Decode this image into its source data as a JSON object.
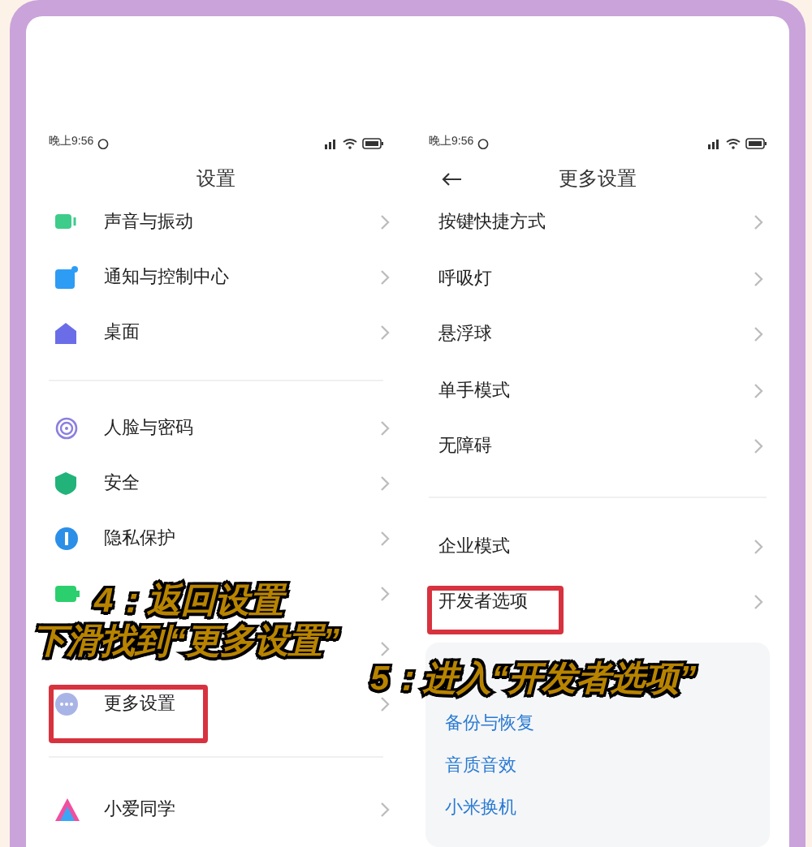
{
  "screens": [
    {
      "status_bar": {
        "time": "晚上9:56"
      },
      "title": "设置",
      "back": false,
      "groups": [
        {
          "items": [
            {
              "kind": "sound",
              "label": "声音与振动"
            },
            {
              "kind": "notice",
              "label": "通知与控制中心"
            },
            {
              "kind": "home",
              "label": "桌面"
            }
          ]
        },
        {
          "items": [
            {
              "kind": "face",
              "label": "人脸与密码"
            },
            {
              "kind": "shield",
              "label": "安全"
            },
            {
              "kind": "privacy",
              "label": "隐私保护"
            },
            {
              "kind": "battery"
            },
            {
              "kind": "covered"
            },
            {
              "kind": "more",
              "label": "更多设置"
            }
          ]
        },
        {
          "items": [
            {
              "kind": "assistant",
              "label": "小爱同学"
            }
          ]
        }
      ]
    },
    {
      "status_bar": {
        "time": "晚上9:56"
      },
      "title": "更多设置",
      "back": true,
      "groups": [
        {
          "items": [
            {
              "label": "按键快捷方式"
            },
            {
              "label": "呼吸灯"
            },
            {
              "label": "悬浮球"
            },
            {
              "label": "单手模式"
            },
            {
              "label": "无障碍"
            }
          ]
        },
        {
          "items": [
            {
              "label": "企业模式"
            },
            {
              "label": "开发者选项"
            }
          ]
        }
      ],
      "card": {
        "links": [
          "备份与恢复",
          "音质音效",
          "小米换机"
        ]
      }
    }
  ],
  "captions": [
    {
      "text": "4：返回设置"
    },
    {
      "text": "下滑找到“更多设置”"
    },
    {
      "text": "5：进入“开发者选项”"
    }
  ]
}
